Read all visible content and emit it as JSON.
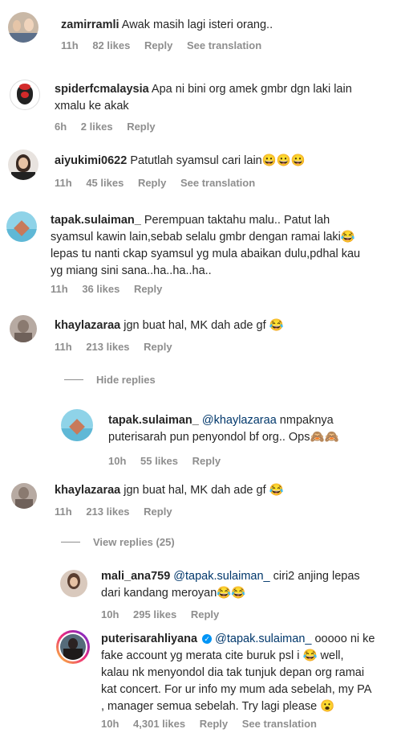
{
  "comments": [
    {
      "user": "zamirramli",
      "text": "Awak masih lagi isteri orang..",
      "time": "11h",
      "likes": "82 likes",
      "reply": "Reply",
      "translate": "See translation"
    },
    {
      "user": "spiderfcmalaysia",
      "text_l1": "Apa ni bini org amek gmbr dgn laki lain",
      "text_l2": "xmalu ke akak",
      "time": "6h",
      "likes": "2 likes",
      "reply": "Reply"
    },
    {
      "user": "aiyukimi0622",
      "text": "Patutlah syamsul cari lain😀😀😀",
      "time": "11h",
      "likes": "45 likes",
      "reply": "Reply",
      "translate": "See translation"
    },
    {
      "user": "tapak.sulaiman_",
      "text_l1": "Perempuan taktahu malu.. Patut lah",
      "text_l2": "syamsul kawin lain,sebab selalu gmbr dengan ramai laki😂",
      "text_l3": "lepas tu nanti ckap syamsul yg mula abaikan dulu,pdhal kau",
      "text_l4": "yg miang sini sana..ha..ha..ha..",
      "time": "11h",
      "likes": "36 likes",
      "reply": "Reply"
    },
    {
      "user": "khaylazaraa",
      "text": "jgn buat hal, MK dah ade gf 😂",
      "time": "11h",
      "likes": "213 likes",
      "reply": "Reply"
    },
    {
      "user": "tapak.sulaiman_",
      "mention": "@khaylazaraa",
      "text_l1": "nmpaknya",
      "text_l2": "puterisarah pun penyondol bf org.. Ops🙈🙈",
      "time": "10h",
      "likes": "55 likes",
      "reply": "Reply"
    },
    {
      "user": "khaylazaraa",
      "text": "jgn buat hal, MK dah ade gf 😂",
      "time": "11h",
      "likes": "213 likes",
      "reply": "Reply"
    },
    {
      "user": "mali_ana759",
      "mention": "@tapak.sulaiman_",
      "text_l1": "ciri2 anjing lepas",
      "text_l2": "dari kandang meroyan😂😂",
      "time": "10h",
      "likes": "295 likes",
      "reply": "Reply"
    },
    {
      "user": "puterisarahliyana",
      "verified": "✓",
      "mention": "@tapak.sulaiman_",
      "text_l1": "ooooo ni ke",
      "text_l2": "fake account yg merata cite buruk psl i 😂 well,",
      "text_l3": "kalau nk menyondol dia tak tunjuk depan org ramai",
      "text_l4": "kat concert. For ur info my mum ada sebelah, my PA",
      "text_l5": ", manager semua sebelah. Try lagi please 😮",
      "time": "10h",
      "likes": "4,301 likes",
      "reply": "Reply",
      "translate": "See translation"
    }
  ],
  "toggles": {
    "hide": "Hide replies",
    "view": "View replies (25)"
  }
}
